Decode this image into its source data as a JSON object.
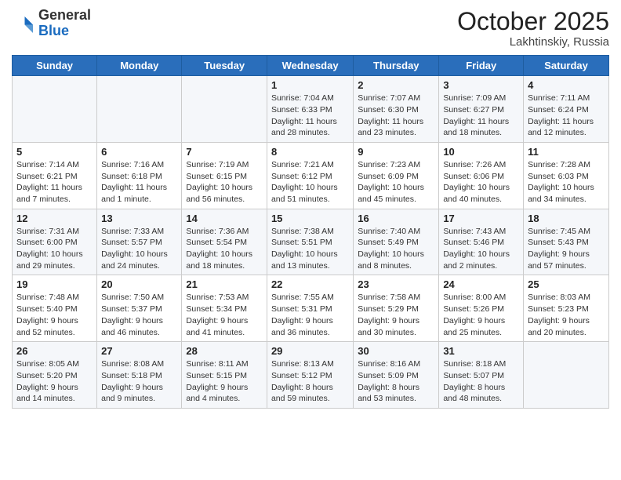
{
  "header": {
    "logo_general": "General",
    "logo_blue": "Blue",
    "month": "October 2025",
    "location": "Lakhtinskiy, Russia"
  },
  "weekdays": [
    "Sunday",
    "Monday",
    "Tuesday",
    "Wednesday",
    "Thursday",
    "Friday",
    "Saturday"
  ],
  "weeks": [
    [
      {
        "day": "",
        "info": ""
      },
      {
        "day": "",
        "info": ""
      },
      {
        "day": "",
        "info": ""
      },
      {
        "day": "1",
        "info": "Sunrise: 7:04 AM\nSunset: 6:33 PM\nDaylight: 11 hours\nand 28 minutes."
      },
      {
        "day": "2",
        "info": "Sunrise: 7:07 AM\nSunset: 6:30 PM\nDaylight: 11 hours\nand 23 minutes."
      },
      {
        "day": "3",
        "info": "Sunrise: 7:09 AM\nSunset: 6:27 PM\nDaylight: 11 hours\nand 18 minutes."
      },
      {
        "day": "4",
        "info": "Sunrise: 7:11 AM\nSunset: 6:24 PM\nDaylight: 11 hours\nand 12 minutes."
      }
    ],
    [
      {
        "day": "5",
        "info": "Sunrise: 7:14 AM\nSunset: 6:21 PM\nDaylight: 11 hours\nand 7 minutes."
      },
      {
        "day": "6",
        "info": "Sunrise: 7:16 AM\nSunset: 6:18 PM\nDaylight: 11 hours\nand 1 minute."
      },
      {
        "day": "7",
        "info": "Sunrise: 7:19 AM\nSunset: 6:15 PM\nDaylight: 10 hours\nand 56 minutes."
      },
      {
        "day": "8",
        "info": "Sunrise: 7:21 AM\nSunset: 6:12 PM\nDaylight: 10 hours\nand 51 minutes."
      },
      {
        "day": "9",
        "info": "Sunrise: 7:23 AM\nSunset: 6:09 PM\nDaylight: 10 hours\nand 45 minutes."
      },
      {
        "day": "10",
        "info": "Sunrise: 7:26 AM\nSunset: 6:06 PM\nDaylight: 10 hours\nand 40 minutes."
      },
      {
        "day": "11",
        "info": "Sunrise: 7:28 AM\nSunset: 6:03 PM\nDaylight: 10 hours\nand 34 minutes."
      }
    ],
    [
      {
        "day": "12",
        "info": "Sunrise: 7:31 AM\nSunset: 6:00 PM\nDaylight: 10 hours\nand 29 minutes."
      },
      {
        "day": "13",
        "info": "Sunrise: 7:33 AM\nSunset: 5:57 PM\nDaylight: 10 hours\nand 24 minutes."
      },
      {
        "day": "14",
        "info": "Sunrise: 7:36 AM\nSunset: 5:54 PM\nDaylight: 10 hours\nand 18 minutes."
      },
      {
        "day": "15",
        "info": "Sunrise: 7:38 AM\nSunset: 5:51 PM\nDaylight: 10 hours\nand 13 minutes."
      },
      {
        "day": "16",
        "info": "Sunrise: 7:40 AM\nSunset: 5:49 PM\nDaylight: 10 hours\nand 8 minutes."
      },
      {
        "day": "17",
        "info": "Sunrise: 7:43 AM\nSunset: 5:46 PM\nDaylight: 10 hours\nand 2 minutes."
      },
      {
        "day": "18",
        "info": "Sunrise: 7:45 AM\nSunset: 5:43 PM\nDaylight: 9 hours\nand 57 minutes."
      }
    ],
    [
      {
        "day": "19",
        "info": "Sunrise: 7:48 AM\nSunset: 5:40 PM\nDaylight: 9 hours\nand 52 minutes."
      },
      {
        "day": "20",
        "info": "Sunrise: 7:50 AM\nSunset: 5:37 PM\nDaylight: 9 hours\nand 46 minutes."
      },
      {
        "day": "21",
        "info": "Sunrise: 7:53 AM\nSunset: 5:34 PM\nDaylight: 9 hours\nand 41 minutes."
      },
      {
        "day": "22",
        "info": "Sunrise: 7:55 AM\nSunset: 5:31 PM\nDaylight: 9 hours\nand 36 minutes."
      },
      {
        "day": "23",
        "info": "Sunrise: 7:58 AM\nSunset: 5:29 PM\nDaylight: 9 hours\nand 30 minutes."
      },
      {
        "day": "24",
        "info": "Sunrise: 8:00 AM\nSunset: 5:26 PM\nDaylight: 9 hours\nand 25 minutes."
      },
      {
        "day": "25",
        "info": "Sunrise: 8:03 AM\nSunset: 5:23 PM\nDaylight: 9 hours\nand 20 minutes."
      }
    ],
    [
      {
        "day": "26",
        "info": "Sunrise: 8:05 AM\nSunset: 5:20 PM\nDaylight: 9 hours\nand 14 minutes."
      },
      {
        "day": "27",
        "info": "Sunrise: 8:08 AM\nSunset: 5:18 PM\nDaylight: 9 hours\nand 9 minutes."
      },
      {
        "day": "28",
        "info": "Sunrise: 8:11 AM\nSunset: 5:15 PM\nDaylight: 9 hours\nand 4 minutes."
      },
      {
        "day": "29",
        "info": "Sunrise: 8:13 AM\nSunset: 5:12 PM\nDaylight: 8 hours\nand 59 minutes."
      },
      {
        "day": "30",
        "info": "Sunrise: 8:16 AM\nSunset: 5:09 PM\nDaylight: 8 hours\nand 53 minutes."
      },
      {
        "day": "31",
        "info": "Sunrise: 8:18 AM\nSunset: 5:07 PM\nDaylight: 8 hours\nand 48 minutes."
      },
      {
        "day": "",
        "info": ""
      }
    ]
  ]
}
